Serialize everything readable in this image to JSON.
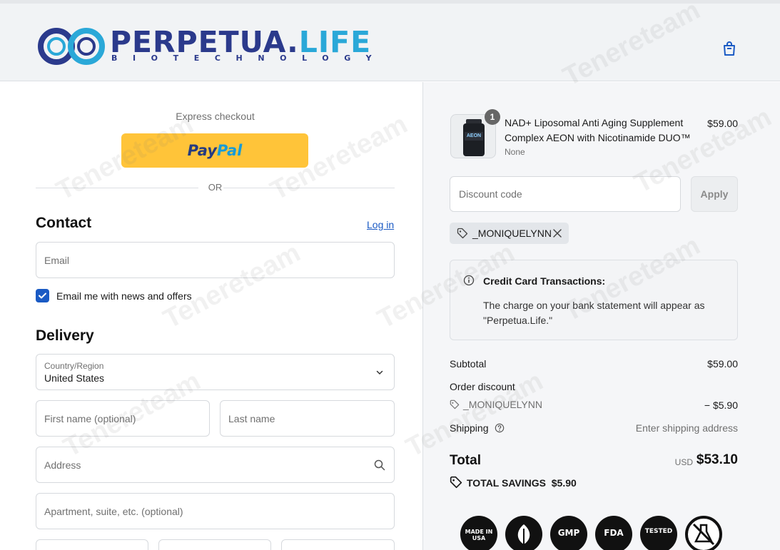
{
  "header": {
    "brand_main": "PERPETUA.",
    "brand_accent": "LIFE",
    "brand_sub": "BIOTECHNOLOGY"
  },
  "checkout": {
    "express_label": "Express checkout",
    "paypal_label_1": "Pay",
    "paypal_label_2": "Pal",
    "or_label": "OR",
    "contact": {
      "heading": "Contact",
      "login_link": "Log in",
      "email_placeholder": "Email",
      "newsletter_label": "Email me with news and offers",
      "newsletter_checked": true
    },
    "delivery": {
      "heading": "Delivery",
      "country_label": "Country/Region",
      "country_value": "United States",
      "first_name_placeholder": "First name (optional)",
      "last_name_placeholder": "Last name",
      "address_placeholder": "Address",
      "apartment_placeholder": "Apartment, suite, etc. (optional)"
    }
  },
  "summary": {
    "product": {
      "quantity": "1",
      "title": "NAD+ Liposomal Anti Aging Supplement Complex AEON with Nicotinamide DUO™",
      "variant": "None",
      "price": "$59.00",
      "bottle_label": "AEON"
    },
    "discount_placeholder": "Discount code",
    "apply_label": "Apply",
    "applied_code": "_MONIQUELYNN",
    "notice": {
      "title": "Credit Card Transactions:",
      "body": "The charge on your bank statement will appear as \"Perpetua.Life.\""
    },
    "subtotal_label": "Subtotal",
    "subtotal_value": "$59.00",
    "order_discount_label": "Order discount",
    "discount_code": "_MONIQUELYNN",
    "discount_value": "− $5.90",
    "shipping_label": "Shipping",
    "shipping_value": "Enter shipping address",
    "total_label": "Total",
    "total_currency": "USD",
    "total_value": "$53.10",
    "savings_label": "TOTAL SAVINGS",
    "savings_value": "$5.90",
    "badges": [
      "MADE IN USA",
      "VEGAN",
      "GMP",
      "FDA",
      "TESTED",
      "NO GMO"
    ]
  },
  "watermark": "Tenereteam",
  "colors": {
    "accent_blue": "#1a5ac4",
    "paypal_yellow": "#ffc439",
    "brand_navy": "#2b3a8c",
    "brand_cyan": "#2aa8d8"
  }
}
